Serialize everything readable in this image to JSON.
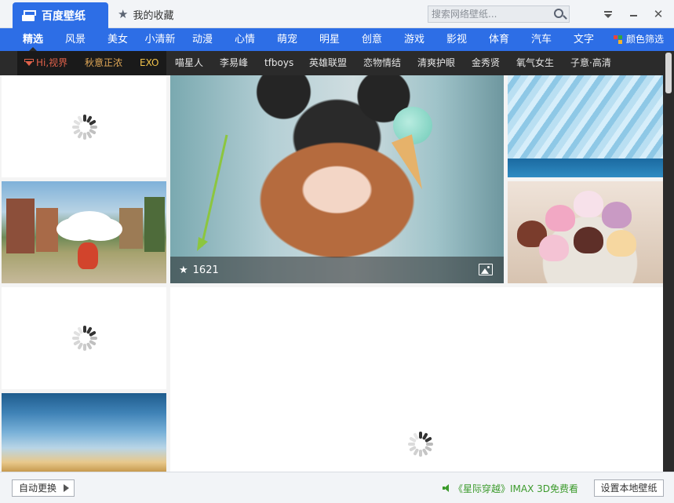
{
  "titlebar": {
    "main_tab": "百度壁纸",
    "fav_tab": "我的收藏",
    "search_placeholder": "搜索网络壁纸..."
  },
  "categories": [
    "精选",
    "风景",
    "美女",
    "小清新",
    "动漫",
    "心情",
    "萌宠",
    "明星",
    "创意",
    "游戏",
    "影视",
    "体育",
    "汽车",
    "文字"
  ],
  "color_filter_label": "颜色筛选",
  "color_filter_colors": [
    "#e8463b",
    "#35a83a",
    "#2d6ee6",
    "#f3b42a"
  ],
  "tags": [
    "Hi,视界",
    "秋意正浓",
    "EXO",
    "喵星人",
    "李易峰",
    "tfboys",
    "英雄联盟",
    "恋物情结",
    "清爽护眼",
    "金秀贤",
    "氧气女生",
    "子意·高清"
  ],
  "tag_colors": {
    "hi_shijie": "#e0614a",
    "qiuyi": "#e1a857",
    "exo": "#f0c24a",
    "default": "#e6e6e6"
  },
  "featured": {
    "favorites_count": "1621"
  },
  "bottom": {
    "auto_change_label": "自动更换",
    "promo_text": "《星际穿越》IMAX 3D免费看",
    "set_local_label": "设置本地壁纸"
  },
  "accent_color": "#2d6ee6"
}
